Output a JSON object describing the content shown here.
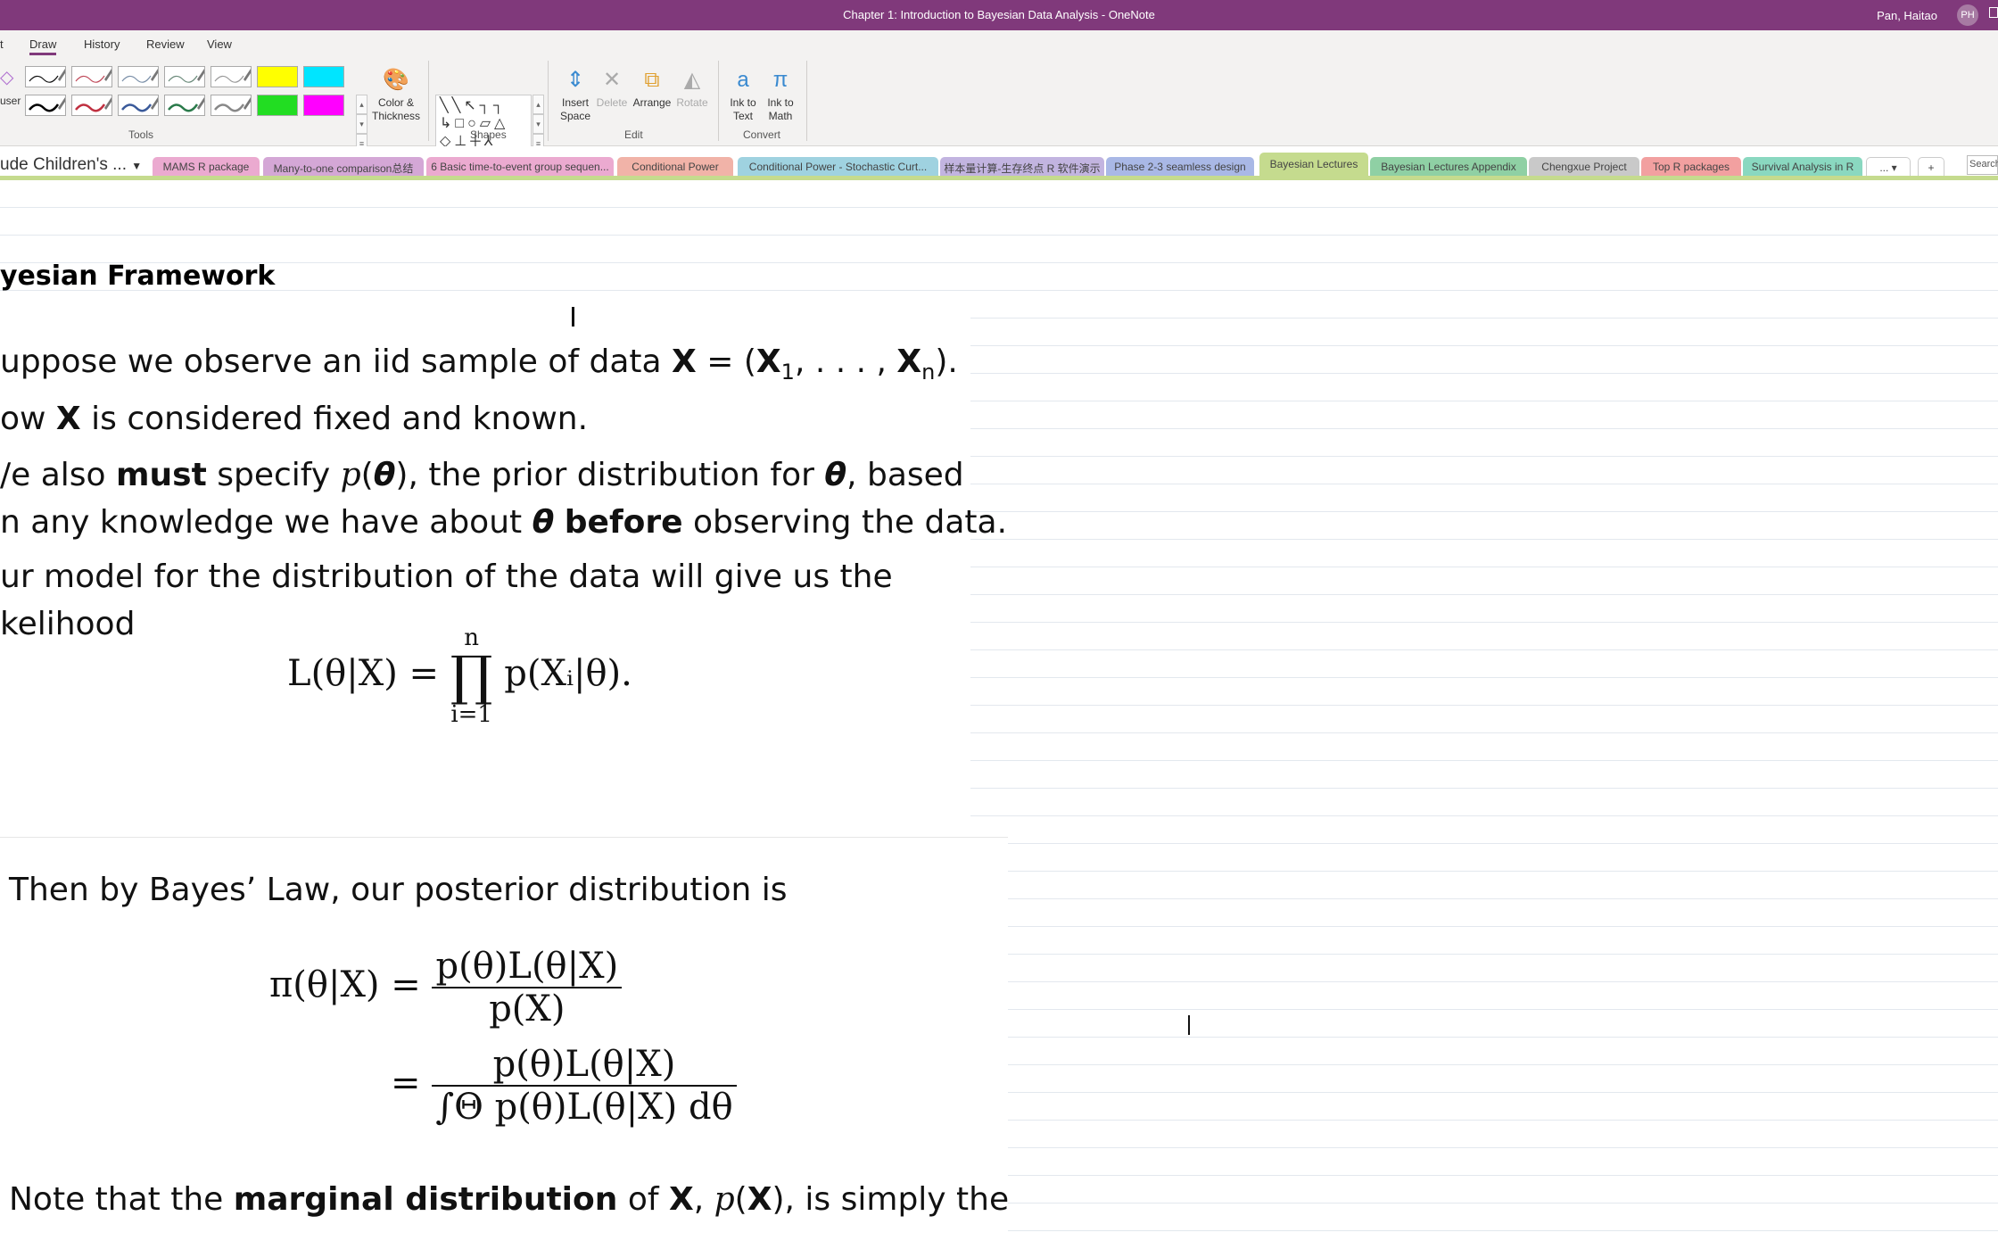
{
  "titlebar": {
    "title": "Chapter 1: Introduction to Bayesian Data Analysis  -  OneNote",
    "user": "Pan, Haitao",
    "avatar": "PH"
  },
  "ribbon": {
    "tabs": [
      {
        "label": "t"
      },
      {
        "label": "Draw",
        "active": true
      },
      {
        "label": "History"
      },
      {
        "label": "Review"
      },
      {
        "label": "View"
      }
    ],
    "eraser_label": "user",
    "pen_colors": [
      "#111111",
      "#c04a5a",
      "#7a8fa8",
      "#6a8a7a",
      "#999999",
      "#ffff00",
      "#00e5ff",
      "#000000",
      "#c03040",
      "#3a5a9a",
      "#2a7a4a",
      "#888888",
      "#22dd22",
      "#ff00ff"
    ],
    "color_thickness": "Color & Thickness",
    "groups": {
      "tools": "Tools",
      "shapes": "Shapes",
      "edit": "Edit",
      "convert": "Convert"
    },
    "buttons": {
      "insert_space": "Insert Space",
      "delete": "Delete",
      "arrange": "Arrange",
      "rotate": "Rotate",
      "ink_to_text": "Ink to Text",
      "ink_to_math": "Ink to Math"
    }
  },
  "notebook": {
    "name": "ude Children's ...",
    "sections": [
      {
        "label": "MAMS R package",
        "color": "#ebaad0"
      },
      {
        "label": "Many-to-one comparison总结",
        "color": "#d4a7d6"
      },
      {
        "label": "6 Basic time-to-event group sequen...",
        "color": "#ebaad0"
      },
      {
        "label": "Conditional Power",
        "color": "#f1b3a8"
      },
      {
        "label": "Conditional Power - Stochastic Curt...",
        "color": "#9fd2e0"
      },
      {
        "label": "样本量计算-生存终点 R 软件演示",
        "color": "#c2b4e0"
      },
      {
        "label": "Phase 2-3 seamless design",
        "color": "#a9b8e6"
      },
      {
        "label": "Bayesian Lectures",
        "color": "#c5db8e",
        "active": true
      },
      {
        "label": "Bayesian Lectures Appendix",
        "color": "#8fd0a4"
      },
      {
        "label": "Chengxue Project",
        "color": "#c9c9c9"
      },
      {
        "label": "Top R packages",
        "color": "#f2a0a0"
      },
      {
        "label": "Survival Analysis in R",
        "color": "#8ad8c0"
      }
    ],
    "more": "... ▾",
    "add": "+",
    "search_placeholder": "Search"
  },
  "page": {
    "heading": "yesian Framework",
    "lines": [
      [
        {
          "t": "uppose we observe an iid sample of data "
        },
        {
          "t": "X",
          "s": "b"
        },
        {
          "t": " = ("
        },
        {
          "t": "X",
          "s": "b"
        },
        {
          "t": "1",
          "s": "sub"
        },
        {
          "t": ", . . . , "
        },
        {
          "t": "X",
          "s": "b"
        },
        {
          "t": "n",
          "s": "sub"
        },
        {
          "t": ")."
        }
      ],
      [
        {
          "t": "ow "
        },
        {
          "t": "X",
          "s": "b"
        },
        {
          "t": " is considered fixed and known."
        }
      ],
      [
        {
          "t": "/e also "
        },
        {
          "t": "must",
          "s": "b"
        },
        {
          "t": " specify "
        },
        {
          "t": "p",
          "s": "i"
        },
        {
          "t": "("
        },
        {
          "t": "θ",
          "s": "bi"
        },
        {
          "t": "), the prior distribution for "
        },
        {
          "t": "θ",
          "s": "bi"
        },
        {
          "t": ", based"
        }
      ],
      [
        {
          "t": "n any knowledge we have about "
        },
        {
          "t": "θ",
          "s": "bi"
        },
        {
          "t": " "
        },
        {
          "t": "before",
          "s": "b"
        },
        {
          "t": " observing the data."
        }
      ],
      [
        {
          "t": "ur model for the distribution of the data will give us the"
        }
      ],
      [
        {
          "t": "kelihood"
        }
      ]
    ],
    "likelihood": {
      "lhs": "L(θ|X) =",
      "prod": "∏",
      "upper": "n",
      "lower": "i=1",
      "rhs": "p(Xᵢ|θ)."
    },
    "bayes_line": [
      {
        "t": "Then by Bayes’ Law, our posterior distribution is"
      }
    ],
    "posterior": {
      "lhs": "π(θ|X) =",
      "num1": "p(θ)L(θ|X)",
      "den1": "p(X)",
      "eq2": "=",
      "num2": "p(θ)L(θ|X)",
      "den2": "∫Θ p(θ)L(θ|X) dθ"
    },
    "note_line": [
      {
        "t": "Note that the "
      },
      {
        "t": "marginal distribution",
        "s": "b"
      },
      {
        "t": " of "
      },
      {
        "t": "X",
        "s": "b"
      },
      {
        "t": ", "
      },
      {
        "t": "p",
        "s": "i"
      },
      {
        "t": "("
      },
      {
        "t": "X",
        "s": "b"
      },
      {
        "t": "), is simply the"
      }
    ]
  }
}
